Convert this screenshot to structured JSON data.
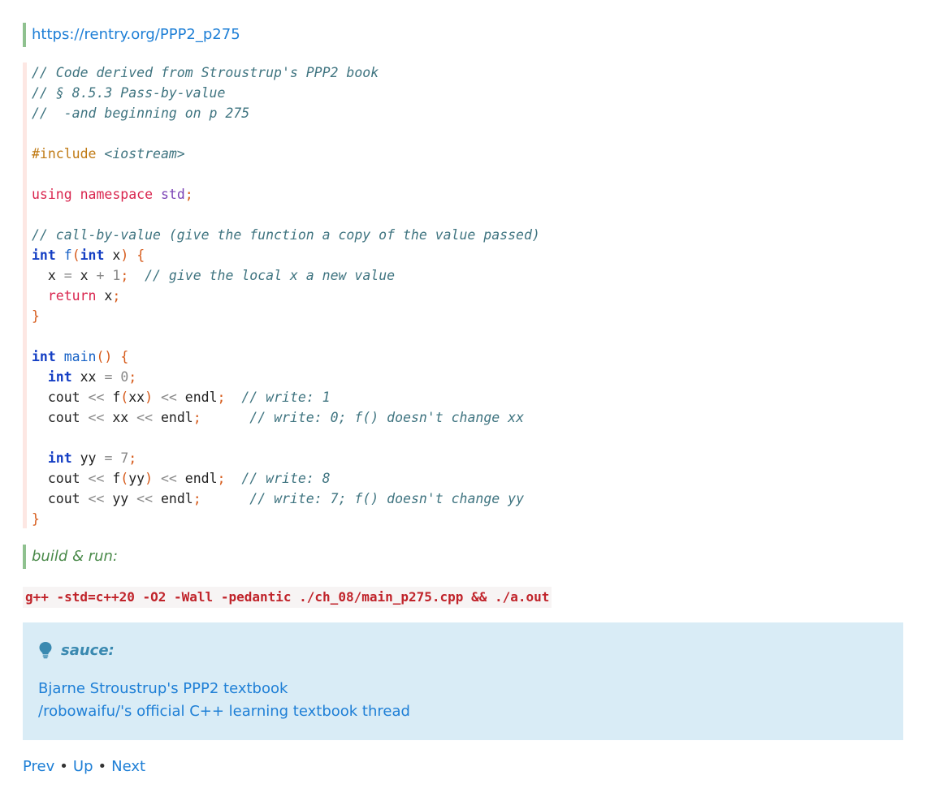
{
  "top_link": "https://rentry.org/PPP2_p275",
  "code_lines": [
    [
      [
        "cm",
        "// Code derived from Stroustrup's PPP2 book"
      ]
    ],
    [
      [
        "cm",
        "// § 8.5.3 Pass-by-value"
      ]
    ],
    [
      [
        "cm",
        "//  -and beginning on p 275"
      ]
    ],
    [],
    [
      [
        "pp",
        "#include "
      ],
      [
        "cm",
        "<iostream>"
      ]
    ],
    [],
    [
      [
        "kw",
        "using"
      ],
      [
        "id",
        " "
      ],
      [
        "kw",
        "namespace"
      ],
      [
        "id",
        " "
      ],
      [
        "ns",
        "std"
      ],
      [
        "pu",
        ";"
      ]
    ],
    [],
    [
      [
        "cm",
        "// call-by-value (give the function a copy of the value passed)"
      ]
    ],
    [
      [
        "ty",
        "int"
      ],
      [
        "id",
        " "
      ],
      [
        "fn",
        "f"
      ],
      [
        "pu",
        "("
      ],
      [
        "ty",
        "int"
      ],
      [
        "id",
        " x"
      ],
      [
        "pu",
        ")"
      ],
      [
        "id",
        " "
      ],
      [
        "pu",
        "{"
      ]
    ],
    [
      [
        "id",
        "  x "
      ],
      [
        "op",
        "="
      ],
      [
        "id",
        " x "
      ],
      [
        "op",
        "+"
      ],
      [
        "id",
        " "
      ],
      [
        "nm",
        "1"
      ],
      [
        "pu",
        ";"
      ],
      [
        "id",
        "  "
      ],
      [
        "cm",
        "// give the local x a new value"
      ]
    ],
    [
      [
        "id",
        "  "
      ],
      [
        "kw",
        "return"
      ],
      [
        "id",
        " x"
      ],
      [
        "pu",
        ";"
      ]
    ],
    [
      [
        "pu",
        "}"
      ]
    ],
    [],
    [
      [
        "ty",
        "int"
      ],
      [
        "id",
        " "
      ],
      [
        "fn",
        "main"
      ],
      [
        "pu",
        "()"
      ],
      [
        "id",
        " "
      ],
      [
        "pu",
        "{"
      ]
    ],
    [
      [
        "id",
        "  "
      ],
      [
        "ty",
        "int"
      ],
      [
        "id",
        " xx "
      ],
      [
        "op",
        "="
      ],
      [
        "id",
        " "
      ],
      [
        "nm",
        "0"
      ],
      [
        "pu",
        ";"
      ]
    ],
    [
      [
        "id",
        "  cout "
      ],
      [
        "op",
        "<<"
      ],
      [
        "id",
        " f"
      ],
      [
        "pu",
        "("
      ],
      [
        "id",
        "xx"
      ],
      [
        "pu",
        ")"
      ],
      [
        "id",
        " "
      ],
      [
        "op",
        "<<"
      ],
      [
        "id",
        " endl"
      ],
      [
        "pu",
        ";"
      ],
      [
        "id",
        "  "
      ],
      [
        "cm",
        "// write: 1"
      ]
    ],
    [
      [
        "id",
        "  cout "
      ],
      [
        "op",
        "<<"
      ],
      [
        "id",
        " xx "
      ],
      [
        "op",
        "<<"
      ],
      [
        "id",
        " endl"
      ],
      [
        "pu",
        ";"
      ],
      [
        "id",
        "      "
      ],
      [
        "cm",
        "// write: 0; f() doesn't change xx"
      ]
    ],
    [],
    [
      [
        "id",
        "  "
      ],
      [
        "ty",
        "int"
      ],
      [
        "id",
        " yy "
      ],
      [
        "op",
        "="
      ],
      [
        "id",
        " "
      ],
      [
        "nm",
        "7"
      ],
      [
        "pu",
        ";"
      ]
    ],
    [
      [
        "id",
        "  cout "
      ],
      [
        "op",
        "<<"
      ],
      [
        "id",
        " f"
      ],
      [
        "pu",
        "("
      ],
      [
        "id",
        "yy"
      ],
      [
        "pu",
        ")"
      ],
      [
        "id",
        " "
      ],
      [
        "op",
        "<<"
      ],
      [
        "id",
        " endl"
      ],
      [
        "pu",
        ";"
      ],
      [
        "id",
        "  "
      ],
      [
        "cm",
        "// write: 8"
      ]
    ],
    [
      [
        "id",
        "  cout "
      ],
      [
        "op",
        "<<"
      ],
      [
        "id",
        " yy "
      ],
      [
        "op",
        "<<"
      ],
      [
        "id",
        " endl"
      ],
      [
        "pu",
        ";"
      ],
      [
        "id",
        "      "
      ],
      [
        "cm",
        "// write: 7; f() doesn't change yy"
      ]
    ],
    [
      [
        "pu",
        "}"
      ]
    ]
  ],
  "build_label": "build & run:",
  "build_command": "g++ -std=c++20 -O2 -Wall -pedantic ./ch_08/main_p275.cpp && ./a.out",
  "note": {
    "icon": "lightbulb-icon",
    "heading": "sauce:",
    "links": [
      "Bjarne Stroustrup's PPP2 textbook",
      "/robowaifu/'s official C++ learning textbook thread"
    ]
  },
  "nav": {
    "prev": "Prev",
    "up": "Up",
    "next": "Next",
    "separator": "•"
  }
}
